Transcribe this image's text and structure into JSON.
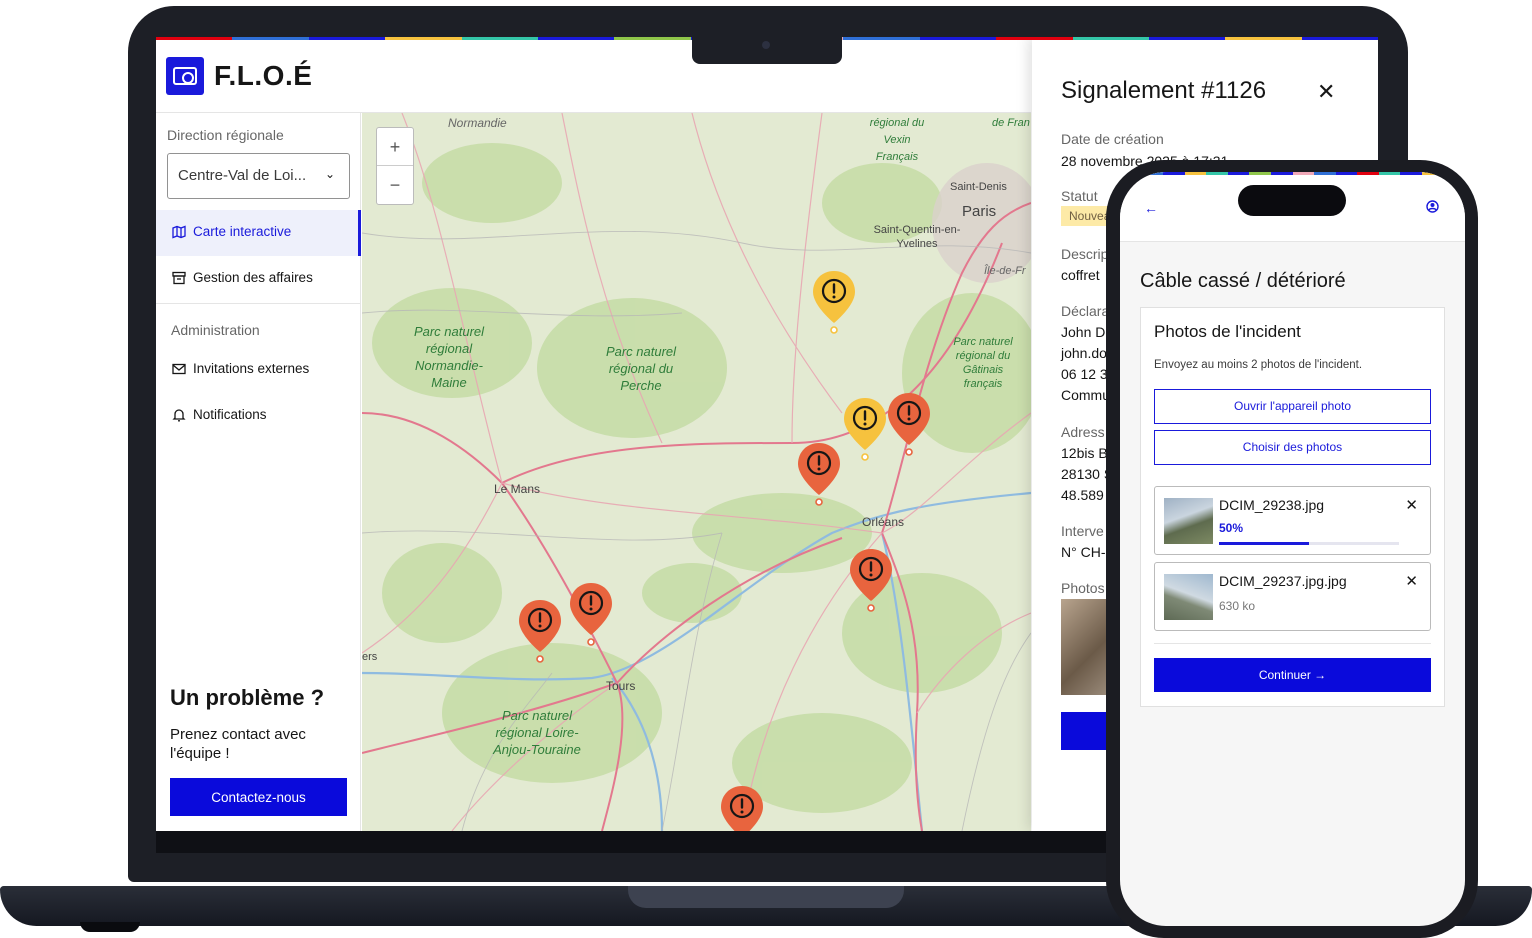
{
  "brand": {
    "name": "F.L.O.É",
    "stripe_colors": [
      "#e1000f",
      "#2f6fd6",
      "#1a1adb",
      "#f6c23e",
      "#34c6a8",
      "#1a1adb",
      "#8fc64a",
      "#1a1adb",
      "#f0a8b8",
      "#2f6fd6",
      "#1a1adb",
      "#e1000f",
      "#34c6a8",
      "#1a1adb",
      "#f6c23e",
      "#1a1adb"
    ]
  },
  "sidebar": {
    "region_label": "Direction régionale",
    "region_value": "Centre-Val de Loi...",
    "nav": [
      {
        "label": "Carte interactive",
        "icon": "map-icon",
        "active": true
      },
      {
        "label": "Gestion des affaires",
        "icon": "archive-icon",
        "active": false
      }
    ],
    "admin_label": "Administration",
    "admin_nav": [
      {
        "label": "Invitations externes",
        "icon": "mail-icon"
      },
      {
        "label": "Notifications",
        "icon": "bell-icon"
      }
    ],
    "help": {
      "title": "Un problème ?",
      "text": "Prenez contact avec l'équipe !",
      "button": "Contactez-nous"
    }
  },
  "map": {
    "zoom_in": "+",
    "zoom_out": "−",
    "labels": {
      "normandie": "Normandie",
      "vexin": "régional du Vexin Français",
      "saint_denis": "Saint-Denis",
      "paris": "Paris",
      "saint_quentin": "Saint-Quentin-en-Yvelines",
      "ile_de_fr": "Île-de-Fr",
      "pnr_normandie": "Parc naturel régional Normandie-Maine",
      "pnr_perche": "Parc naturel régional du Perche",
      "pnr_gatinais": "Parc naturel régional du Gâtinais français",
      "le_mans": "Le Mans",
      "orleans": "Orléans",
      "tours": "Tours",
      "pnr_loire": "Parc naturel régional Loire-Anjou-Touraine",
      "de_fr": "de Fran",
      "ers": "ers"
    },
    "pins": [
      {
        "status": "nouveau",
        "color": "#f6c23e"
      },
      {
        "status": "nouveau",
        "color": "#f6c23e"
      },
      {
        "status": "urgent",
        "color": "#e8643e"
      },
      {
        "status": "urgent",
        "color": "#e8643e"
      },
      {
        "status": "urgent",
        "color": "#e8643e"
      },
      {
        "status": "urgent",
        "color": "#e8643e"
      },
      {
        "status": "urgent",
        "color": "#e8643e"
      },
      {
        "status": "urgent",
        "color": "#e8643e"
      }
    ]
  },
  "panel": {
    "title": "Signalement #1126",
    "close": "✕",
    "created_label": "Date de création",
    "created_value": "28 novembre 2025 à 17:31",
    "status_label": "Statut",
    "status_value": "Nouveau",
    "desc_label": "Descrip",
    "desc_value": "coffret",
    "declarant_label": "Déclara",
    "declarant_lines": [
      "John Do",
      "john.do",
      "06 12 3",
      "Commu"
    ],
    "address_label": "Adress",
    "address_lines": [
      "12bis Bo",
      "28130 S",
      "48.589"
    ],
    "intervention_label": "Interve",
    "intervention_value": "N° CH-",
    "photos_label": "Photos"
  },
  "phone": {
    "back": "←",
    "title": "Câble cassé / détérioré",
    "card_title": "Photos de l'incident",
    "card_subtitle": "Envoyez au moins 2 photos de l'incident.",
    "btn_camera": "Ouvrir l'appareil photo",
    "btn_choose": "Choisir des photos",
    "files": [
      {
        "name": "DCIM_29238.jpg",
        "progress_label": "50%",
        "progress": 0.5
      },
      {
        "name": "DCIM_29237.jpg.jpg",
        "size": "630 ko"
      }
    ],
    "remove": "✕",
    "continue": "Continuer  →"
  }
}
